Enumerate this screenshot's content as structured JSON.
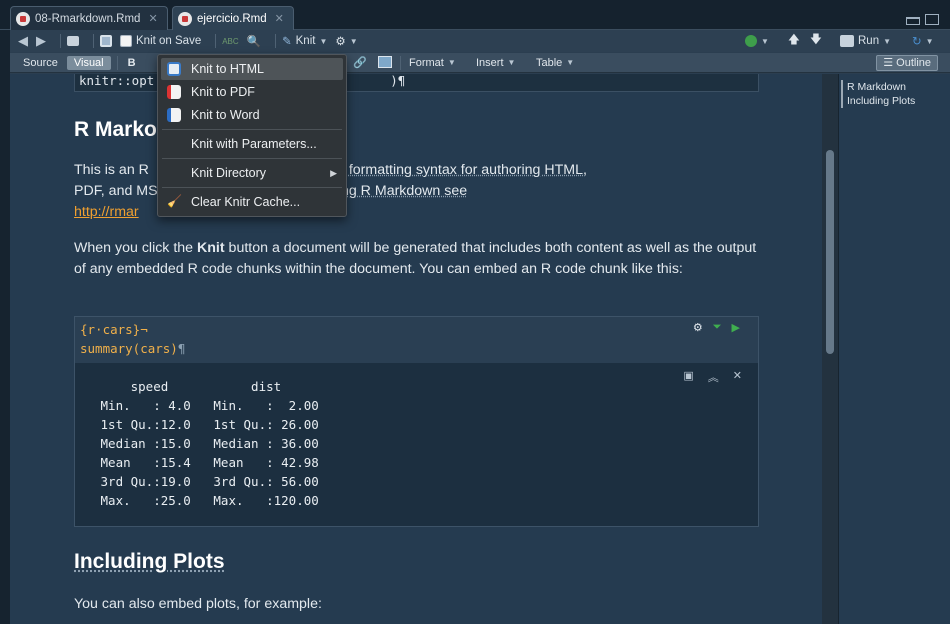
{
  "tabs": [
    {
      "label": "08-Rmarkdown.Rmd",
      "active": false
    },
    {
      "label": "ejercicio.Rmd",
      "active": true
    }
  ],
  "toolbar": {
    "knit_on_save_label": "Knit on Save",
    "knit_label": "Knit",
    "run_label": "Run"
  },
  "editor_toolbar": {
    "source_label": "Source",
    "visual_label": "Visual",
    "bold_label": "B",
    "format_label": "Format",
    "insert_label": "Insert",
    "table_label": "Table",
    "outline_label": "Outline"
  },
  "outline": {
    "items": [
      "R Markdown",
      "Including Plots"
    ]
  },
  "document": {
    "prev_code": "knitr::opt",
    "prev_code_tail": ")¶",
    "heading1": "R Marko",
    "para1_line1_a": "This is an R",
    "para1_line1_b": "kdown is a simple formatting syntax for authoring HTML,",
    "para1_line2_a": "PDF, and MS",
    "para1_line2_b": "re details on using R Markdown see",
    "para1_link": "http://rmar",
    "para2_a": "When you click the ",
    "para2_bold": "Knit",
    "para2_b": " button a document will be generated that includes both content as well as the output of any embedded R code chunks within the document. You can embed an R code chunk like this:",
    "chunk_header": "{r·cars}¬",
    "chunk_code_fn": "summary(cars)",
    "chunk_code_pilcrow": "¶",
    "chunk_output": "     speed           dist       \n Min.   : 4.0   Min.   :  2.00  \n 1st Qu.:12.0   1st Qu.: 26.00  \n Median :15.0   Median : 36.00  \n Mean   :15.4   Mean   : 42.98  \n 3rd Qu.:19.0   3rd Qu.: 56.00  \n Max.   :25.0   Max.   :120.00  ",
    "heading2": "Including Plots",
    "para3": "You can also embed plots, for example:"
  },
  "knit_menu": {
    "items": [
      {
        "label": "Knit to HTML",
        "icon": "html-icon"
      },
      {
        "label": "Knit to PDF",
        "icon": "pdf-icon"
      },
      {
        "label": "Knit to Word",
        "icon": "word-icon"
      },
      {
        "label": "Knit with Parameters...",
        "icon": ""
      },
      {
        "label": "Knit Directory",
        "icon": ""
      },
      {
        "label": "Clear Knitr Cache...",
        "icon": "broom-icon"
      }
    ]
  }
}
